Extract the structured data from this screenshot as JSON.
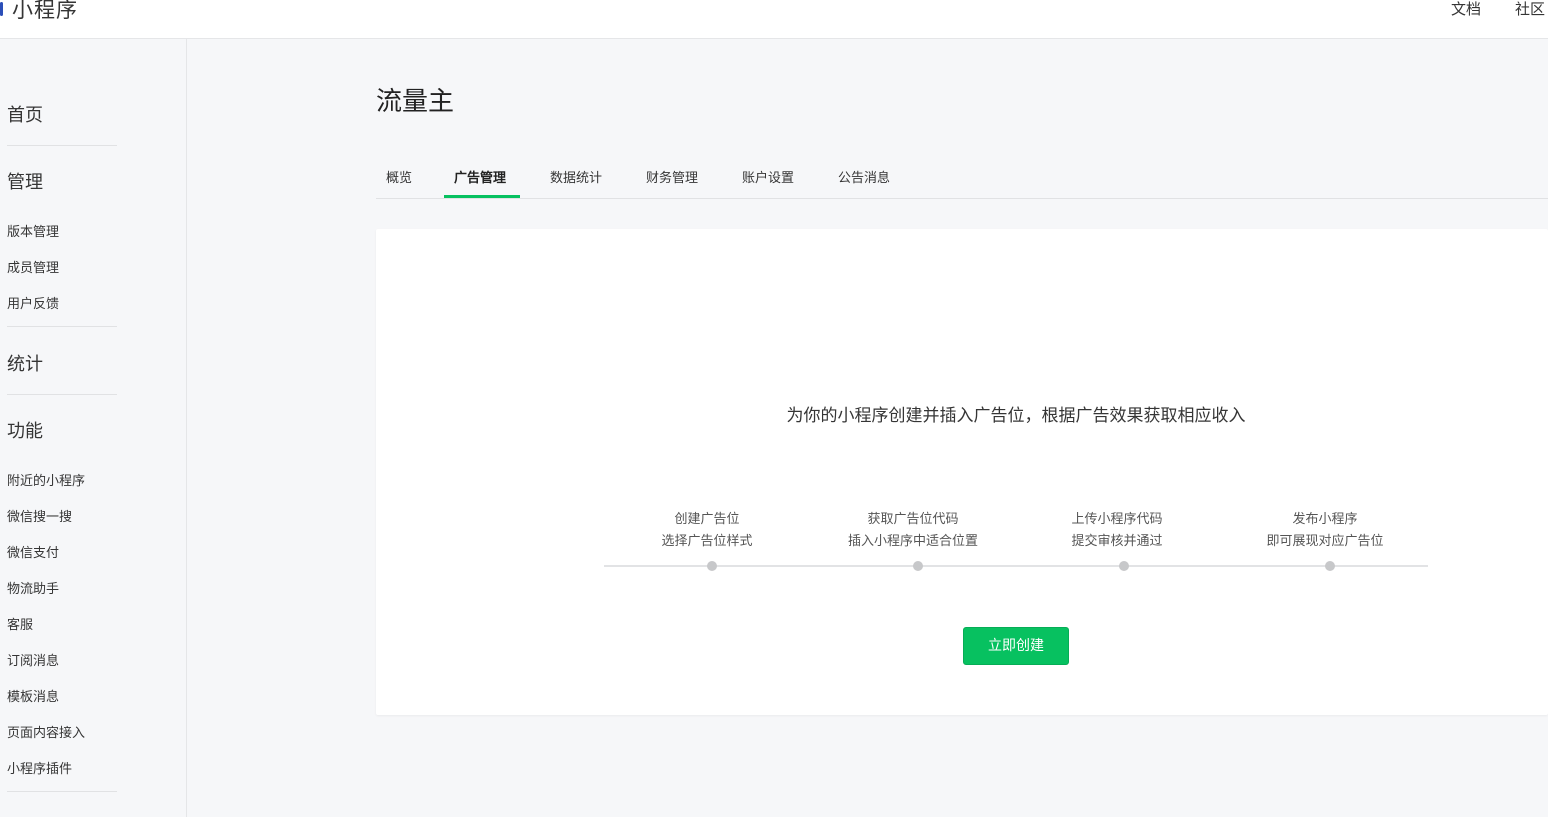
{
  "header": {
    "brand": "小程序",
    "nav": {
      "docs": "文档",
      "community": "社区"
    }
  },
  "sidebar": {
    "home": "首页",
    "manage": {
      "title": "管理",
      "items": [
        "版本管理",
        "成员管理",
        "用户反馈"
      ]
    },
    "stats": "统计",
    "features": {
      "title": "功能",
      "items": [
        "附近的小程序",
        "微信搜一搜",
        "微信支付",
        "物流助手",
        "客服",
        "订阅消息",
        "模板消息",
        "页面内容接入",
        "小程序插件"
      ]
    }
  },
  "main": {
    "title": "流量主",
    "tabs": [
      "概览",
      "广告管理",
      "数据统计",
      "财务管理",
      "账户设置",
      "公告消息"
    ],
    "active_tab": "广告管理",
    "intro": "为你的小程序创建并插入广告位，根据广告效果获取相应收入",
    "steps": [
      {
        "title": "创建广告位",
        "desc": "选择广告位样式"
      },
      {
        "title": "获取广告位代码",
        "desc": "插入小程序中适合位置"
      },
      {
        "title": "上传小程序代码",
        "desc": "提交审核并通过"
      },
      {
        "title": "发布小程序",
        "desc": "即可展现对应广告位"
      }
    ],
    "create_button": "立即创建"
  },
  "colors": {
    "accent": "#07c160",
    "background": "#f6f7f9",
    "card": "#ffffff"
  }
}
